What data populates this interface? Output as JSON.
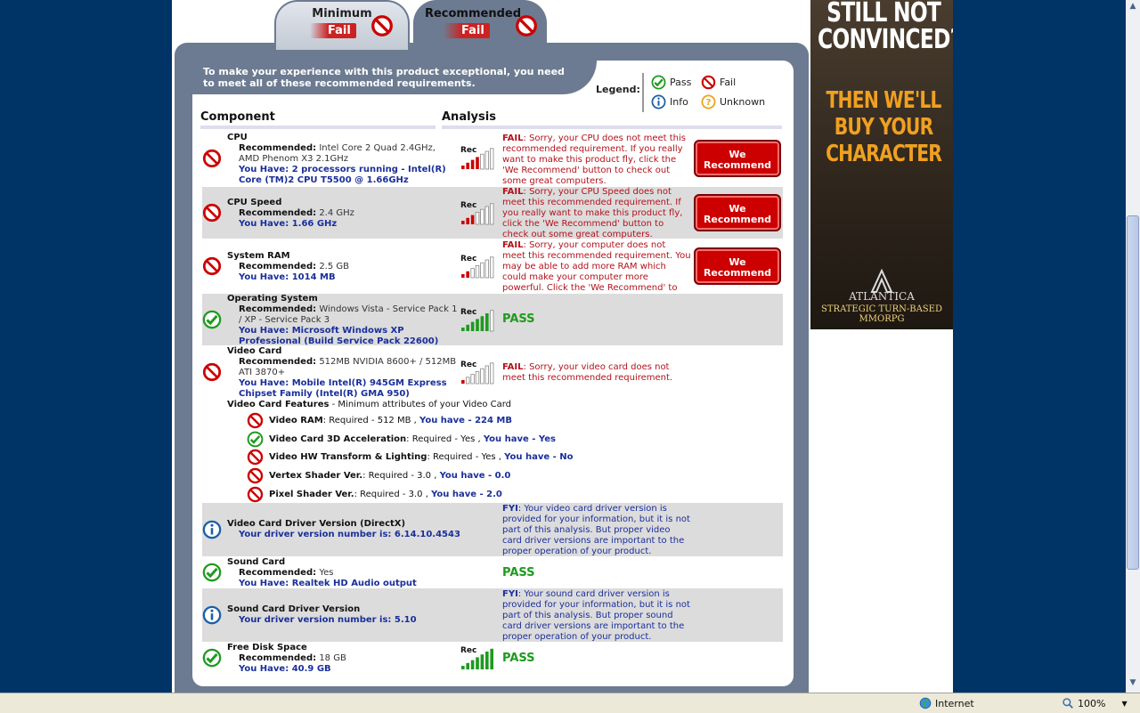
{
  "tabs": {
    "minimum": {
      "title": "Minimum",
      "status": "Fail"
    },
    "recommended": {
      "title": "Recommended",
      "status": "Fail"
    }
  },
  "intro": "To make your experience with this product exceptional, you need to meet all of these recommended requirements.",
  "legend": {
    "label": "Legend:",
    "pass": "Pass",
    "fail": "Fail",
    "info": "Info",
    "unknown": "Unknown"
  },
  "columns": {
    "component": "Component",
    "analysis": "Analysis"
  },
  "meter_label": "Rec",
  "rows": {
    "cpu": {
      "name": "CPU",
      "rec_label": "Recommended:",
      "rec_value": "Intel Core 2 Quad 2.4GHz, AMD Phenom X3 2.1GHz",
      "have": "You Have: 2 processors running - Intel(R) Core (TM)2 CPU T5500 @ 1.66GHz",
      "fail_label": "FAIL",
      "message": ": Sorry, your CPU does not meet this recommended requirement. If you really want to make this product fly, click the 'We Recommend' button to check out some great computers.",
      "button": "We Recommend",
      "level": 4
    },
    "cpu_speed": {
      "name": "CPU Speed",
      "rec_label": "Recommended:",
      "rec_value": "2.4 GHz",
      "have": "You Have: 1.66 GHz",
      "fail_label": "FAIL",
      "message": ": Sorry, your CPU Speed does not meet this recommended requirement. If you really want to make this product fly, click the 'We Recommend' button to check out some great computers.",
      "button": "We Recommend",
      "level": 3
    },
    "ram": {
      "name": "System RAM",
      "rec_label": "Recommended:",
      "rec_value": "2.5 GB",
      "have": "You Have: 1014 MB",
      "fail_label": "FAIL",
      "message": ": Sorry, your computer does not meet this recommended requirement. You may be able to add more RAM which could make your computer more powerful. Click the 'We Recommend' to see how.",
      "button": "We Recommend",
      "level": 2
    },
    "os": {
      "name": "Operating System",
      "rec_label": "Recommended:",
      "rec_value": "Windows Vista - Service Pack 1 / XP - Service Pack 3",
      "have": "You Have: Microsoft Windows XP Professional (Build Service Pack 22600)",
      "result": "PASS",
      "level": 6
    },
    "video": {
      "name": "Video Card",
      "rec_label": "Recommended:",
      "rec_value": "512MB NVIDIA 8600+ / 512MB ATI 3870+",
      "have": "You Have: Mobile Intel(R) 945GM Express Chipset Family (Intel(R) GMA 950)",
      "fail_label": "FAIL",
      "message": ": Sorry, your video card does not meet this recommended requirement.",
      "level": 1,
      "features_label": "Video Card Features",
      "features_desc": " - Minimum attributes of your Video Card",
      "features": [
        {
          "name": "Video RAM",
          "req": ": Required - 512 MB , ",
          "have": "You have - 224 MB",
          "status": "fail"
        },
        {
          "name": "Video Card 3D Acceleration",
          "req": ": Required - Yes , ",
          "have": "You have - Yes",
          "status": "pass"
        },
        {
          "name": "Video HW Transform & Lighting",
          "req": ": Required - Yes , ",
          "have": "You have - No",
          "status": "fail"
        },
        {
          "name": "Vertex Shader Ver.",
          "req": ": Required - 3.0 , ",
          "have": "You have - 0.0",
          "status": "fail"
        },
        {
          "name": "Pixel Shader Ver.",
          "req": ": Required - 3.0 , ",
          "have": "You have - 2.0",
          "status": "fail"
        }
      ]
    },
    "video_driver": {
      "name": "Video Card Driver Version (DirectX)",
      "have": "Your driver version number is: 6.14.10.4543",
      "fyi_label": "FYI",
      "message": ": Your video card driver version is provided for your information, but it is not part of this analysis. But proper video card driver versions are important to the proper operation of your product."
    },
    "sound": {
      "name": "Sound Card",
      "rec_label": "Recommended:",
      "rec_value": "Yes",
      "have": "You Have: Realtek HD Audio output",
      "result": "PASS"
    },
    "sound_driver": {
      "name": "Sound Card Driver Version",
      "have": "Your driver version number is: 5.10",
      "fyi_label": "FYI",
      "message": ": Your sound card driver version is provided for your information, but it is not part of this analysis. But proper sound card driver versions are important to the proper operation of your product."
    },
    "disk": {
      "name": "Free Disk Space",
      "rec_label": "Recommended:",
      "rec_value": "18 GB",
      "have": "You Have: 40.9 GB",
      "result": "PASS",
      "level": 7
    }
  },
  "ad": {
    "headline1": "STILL NOT CONVINCED?",
    "headline2": "THEN WE'LL BUY YOUR CHARACTER",
    "brand": "ATLANTICA",
    "tagline": "STRATEGIC TURN-BASED MMORPG"
  },
  "status_bar": {
    "zone": "Internet",
    "zoom": "100%"
  },
  "colors": {
    "pass": "#1f9a1f",
    "fail": "#cc0000",
    "info": "#1a5fa8",
    "unknown": "#e8a317"
  }
}
